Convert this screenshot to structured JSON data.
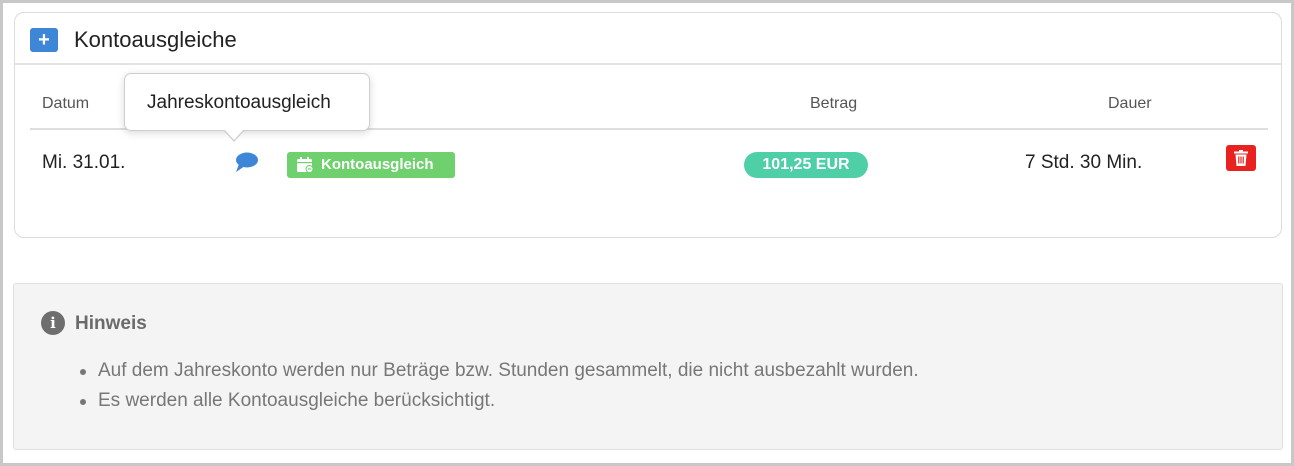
{
  "card": {
    "title": "Kontoausgleiche",
    "add_button": "+",
    "columns": {
      "date": "Datum",
      "amount": "Betrag",
      "duration": "Dauer"
    },
    "tooltip": "Jahreskontoausgleich",
    "rows": [
      {
        "date": "Mi. 31.01.",
        "comment_icon": "comment-icon",
        "tag": "Kontoausgleich",
        "tag_icon": "calendar-icon",
        "amount": "101,25 EUR",
        "duration": "7 Std. 30 Min.",
        "delete_icon": "trash-icon"
      }
    ]
  },
  "note": {
    "icon": "info-icon",
    "icon_glyph": "i",
    "title": "Hinweis",
    "items": [
      "Auf dem Jahreskonto werden nur Beträge bzw. Stunden gesammelt, die nicht ausbezahlt wurden.",
      "Es werden alle Kontoausgleiche berücksichtigt."
    ]
  },
  "colors": {
    "add_button": "#3d87d6",
    "tag_green": "#6fd06e",
    "amount_pill": "#4fcfa6",
    "delete_red": "#e8231f",
    "comment_blue": "#3d87d6"
  }
}
